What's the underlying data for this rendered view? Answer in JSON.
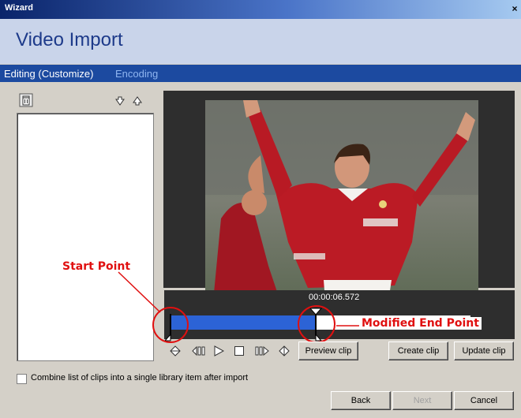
{
  "window": {
    "title": "Wizard",
    "close_label": "×"
  },
  "header": {
    "title": "Video Import"
  },
  "steps": [
    {
      "label": "Editing (Customize)"
    },
    {
      "label": "Encoding"
    }
  ],
  "video": {
    "timecode": "00:00:06.572",
    "progress": 0.486
  },
  "buttons": {
    "preview": "Preview clip",
    "create": "Create clip",
    "update": "Update clip",
    "back": "Back",
    "next": "Next",
    "cancel": "Cancel"
  },
  "checkbox": {
    "label": "Combine list of clips into a single library item after import",
    "checked": false
  },
  "annotations": {
    "start": "Start Point",
    "end": "Modified End Point",
    "color": "#e01010"
  },
  "colors": {
    "titlebar": "#0a246a",
    "stepbar": "#1c4aa0",
    "header_bg": "#c9d4ea",
    "track": "#2c63d6"
  }
}
